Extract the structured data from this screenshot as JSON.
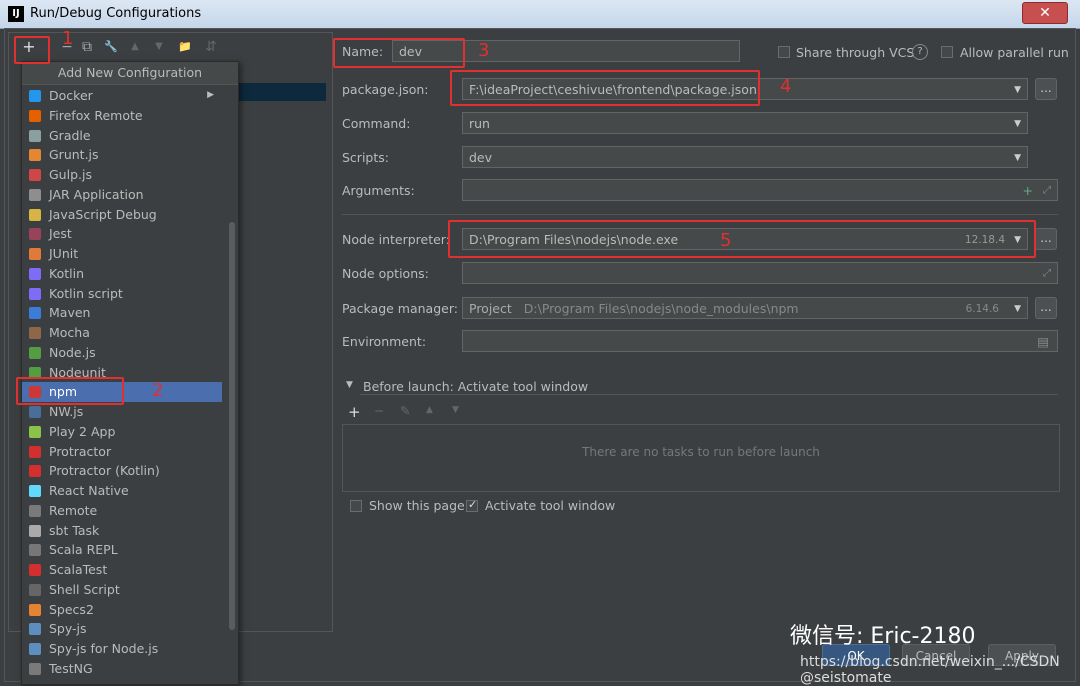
{
  "window": {
    "title": "Run/Debug Configurations",
    "close_label": "✕"
  },
  "toolbar": {
    "add": "+",
    "remove": "−",
    "copy": "⧉",
    "edit": "🔧",
    "up": "▲",
    "down": "▼",
    "folder": "📁",
    "sort": "⇵"
  },
  "popup": {
    "header": "Add New Configuration",
    "items": [
      {
        "label": "Docker",
        "icon": "docker-icon",
        "color": "#2496ed"
      },
      {
        "label": "Firefox Remote",
        "icon": "firefox-icon",
        "color": "#e66000"
      },
      {
        "label": "Gradle",
        "icon": "gradle-icon",
        "color": "#8aa0a0"
      },
      {
        "label": "Grunt.js",
        "icon": "grunt-icon",
        "color": "#e48632"
      },
      {
        "label": "Gulp.js",
        "icon": "gulp-icon",
        "color": "#cf4647"
      },
      {
        "label": "JAR Application",
        "icon": "jar-icon",
        "color": "#8e8e8e"
      },
      {
        "label": "JavaScript Debug",
        "icon": "js-debug-icon",
        "color": "#d7b545"
      },
      {
        "label": "Jest",
        "icon": "jest-icon",
        "color": "#99425b"
      },
      {
        "label": "JUnit",
        "icon": "junit-icon",
        "color": "#e07a3a"
      },
      {
        "label": "Kotlin",
        "icon": "kotlin-icon",
        "color": "#7f6cf6"
      },
      {
        "label": "Kotlin script",
        "icon": "kotlin-script-icon",
        "color": "#7f6cf6"
      },
      {
        "label": "Maven",
        "icon": "maven-icon",
        "color": "#3d7bd9"
      },
      {
        "label": "Mocha",
        "icon": "mocha-icon",
        "color": "#8d6748"
      },
      {
        "label": "Node.js",
        "icon": "nodejs-icon",
        "color": "#539e43"
      },
      {
        "label": "Nodeunit",
        "icon": "nodeunit-icon",
        "color": "#539e43"
      },
      {
        "label": "npm",
        "icon": "npm-icon",
        "color": "#cb3837"
      },
      {
        "label": "NW.js",
        "icon": "nwjs-icon",
        "color": "#4a6e9a"
      },
      {
        "label": "Play 2 App",
        "icon": "play-icon",
        "color": "#8bc34a"
      },
      {
        "label": "Protractor",
        "icon": "protractor-icon",
        "color": "#d32f2f"
      },
      {
        "label": "Protractor (Kotlin)",
        "icon": "protractor-kotlin-icon",
        "color": "#d32f2f"
      },
      {
        "label": "React Native",
        "icon": "react-icon",
        "color": "#61dafb"
      },
      {
        "label": "Remote",
        "icon": "remote-icon",
        "color": "#7a7a7a"
      },
      {
        "label": "sbt Task",
        "icon": "sbt-icon",
        "color": "#aaaaaa"
      },
      {
        "label": "Scala REPL",
        "icon": "scala-repl-icon",
        "color": "#777777"
      },
      {
        "label": "ScalaTest",
        "icon": "scalatest-icon",
        "color": "#d32f2f"
      },
      {
        "label": "Shell Script",
        "icon": "shell-icon",
        "color": "#666666"
      },
      {
        "label": "Specs2",
        "icon": "specs2-icon",
        "color": "#e28431"
      },
      {
        "label": "Spy-js",
        "icon": "spyjs-icon",
        "color": "#5c8fbf"
      },
      {
        "label": "Spy-js for Node.js",
        "icon": "spyjs-node-icon",
        "color": "#5c8fbf"
      },
      {
        "label": "TestNG",
        "icon": "testng-icon",
        "color": "#7a7a7a"
      }
    ]
  },
  "form": {
    "name_label": "Name:",
    "name_value": "dev",
    "share_label": "Share through VCS",
    "parallel_label": "Allow parallel run",
    "help": "?",
    "packagejson_label": "package.json:",
    "packagejson_value": "F:\\ideaProject\\ceshivue\\frontend\\package.json",
    "command_label": "Command:",
    "command_value": "run",
    "scripts_label": "Scripts:",
    "scripts_value": "dev",
    "arguments_label": "Arguments:",
    "node_interp_label": "Node interpreter:",
    "node_interp_value": "D:\\Program Files\\nodejs\\node.exe",
    "node_version": "12.18.4",
    "node_options_label": "Node options:",
    "pkg_mgr_label": "Package manager:",
    "pkg_mgr_project": "Project",
    "pkg_mgr_path": "D:\\Program Files\\nodejs\\node_modules\\npm",
    "pkg_mgr_version": "6.14.6",
    "env_label": "Environment:",
    "before_launch": "Before launch: Activate tool window",
    "no_tasks": "There are no tasks to run before launch",
    "show_page": "Show this page",
    "activate_tool": "Activate tool window",
    "ellipsis": "..."
  },
  "buttons": {
    "ok": "OK",
    "cancel": "Cancel",
    "apply": "Apply"
  },
  "annotations": {
    "n1": "1",
    "n2": "2",
    "n3": "3",
    "n4": "4",
    "n5": "5"
  },
  "watermark": {
    "text": "微信号: Eric-2180",
    "url": "https://blog.csdn.net/weixin_.../CSDN @seistomate"
  }
}
